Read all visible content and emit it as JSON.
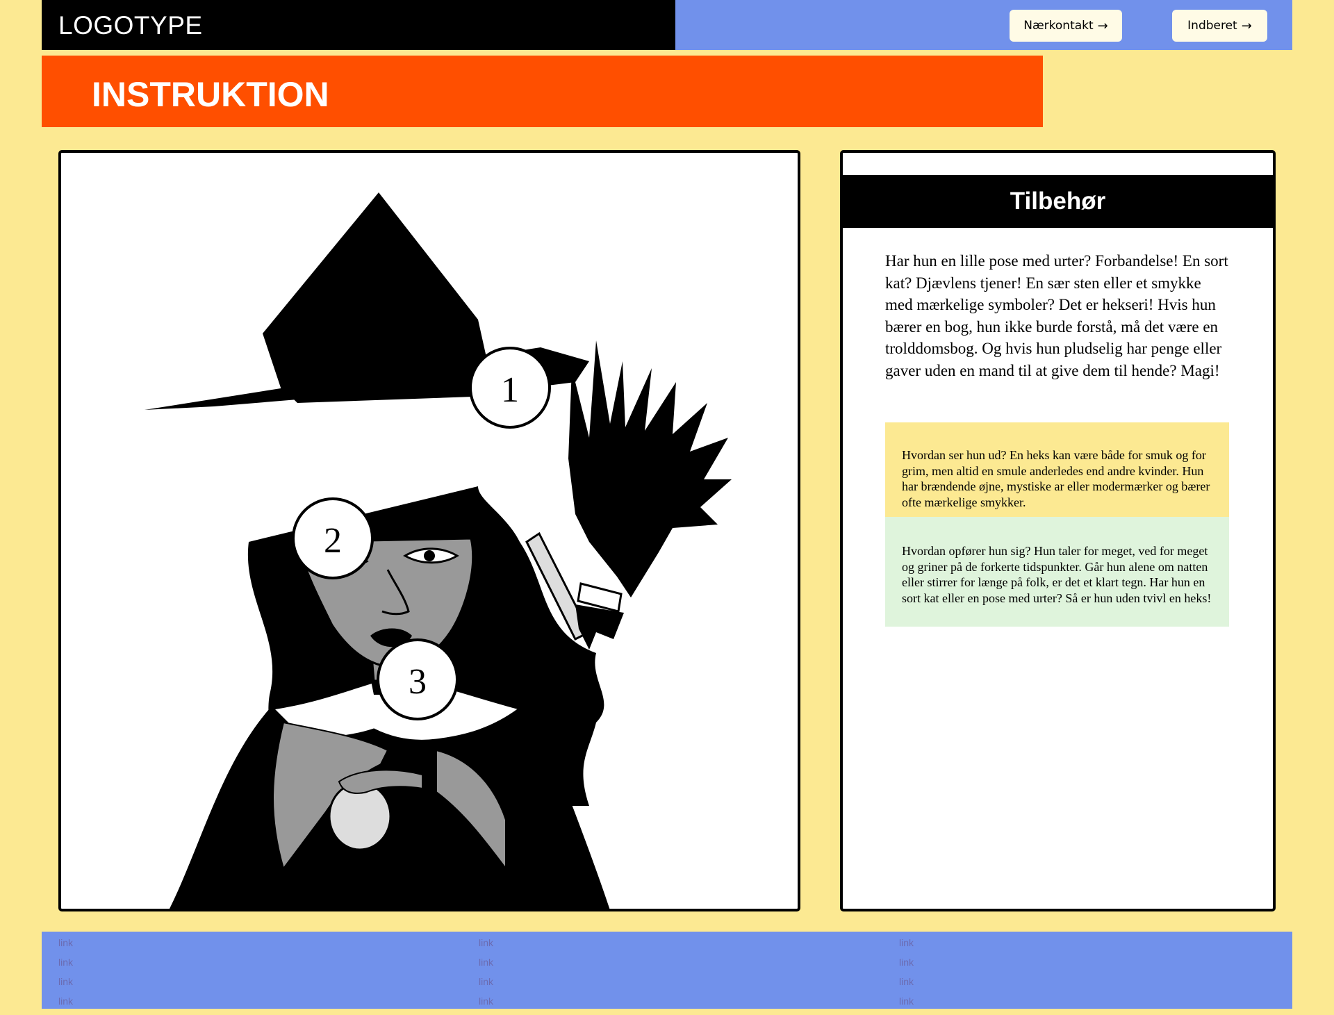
{
  "header": {
    "logo": "LOGOTYPE",
    "buttons": [
      {
        "label": "Nærkontakt",
        "icon": "arrow-right-icon"
      },
      {
        "label": "Indberet",
        "icon": "arrow-right-icon"
      }
    ],
    "colors": {
      "left": "#000000",
      "right": "#7191eb",
      "button_bg": "#fffbe6"
    }
  },
  "banner": {
    "title": "INSTRUKTION",
    "color": "#ff4f00"
  },
  "illustration": {
    "markers": [
      "1",
      "2",
      "3"
    ]
  },
  "sidebar": {
    "title": "Tilbehør",
    "text": "Har hun en lille pose med urter? Forbandelse! En sort kat? Djævlens tjener! En sær sten eller et smykke med mærkelige symboler? Det er hekseri! Hvis hun bærer en bog, hun ikke burde forstå, må det være en trolddomsbog. Og hvis hun pludselig har penge eller gaver uden en mand til at give dem til hende? Magi!",
    "boxes": [
      {
        "text": "Hvordan ser hun ud? En heks kan være både for smuk og for grim, men altid en smule anderledes end andre kvinder. Hun har brændende øjne, mystiske ar eller modermærker og bærer ofte mærkelige smykker.",
        "color": "#fce992"
      },
      {
        "text": "Hvordan opfører hun sig? Hun taler for meget, ved for meget og griner på de forkerte tidspunkter. Går hun alene om natten eller stirrer for længe på folk, er det et klart tegn. Har hun en sort kat eller en pose med urter? Så er hun uden tvivl en heks!",
        "color": "#dff4dc"
      }
    ]
  },
  "footer": {
    "columns": [
      [
        "link",
        "link",
        "link",
        "link"
      ],
      [
        "link",
        "link",
        "link",
        "link"
      ],
      [
        "link",
        "link",
        "link",
        "link"
      ]
    ],
    "color": "#7191eb"
  },
  "page_background": "#fce992"
}
